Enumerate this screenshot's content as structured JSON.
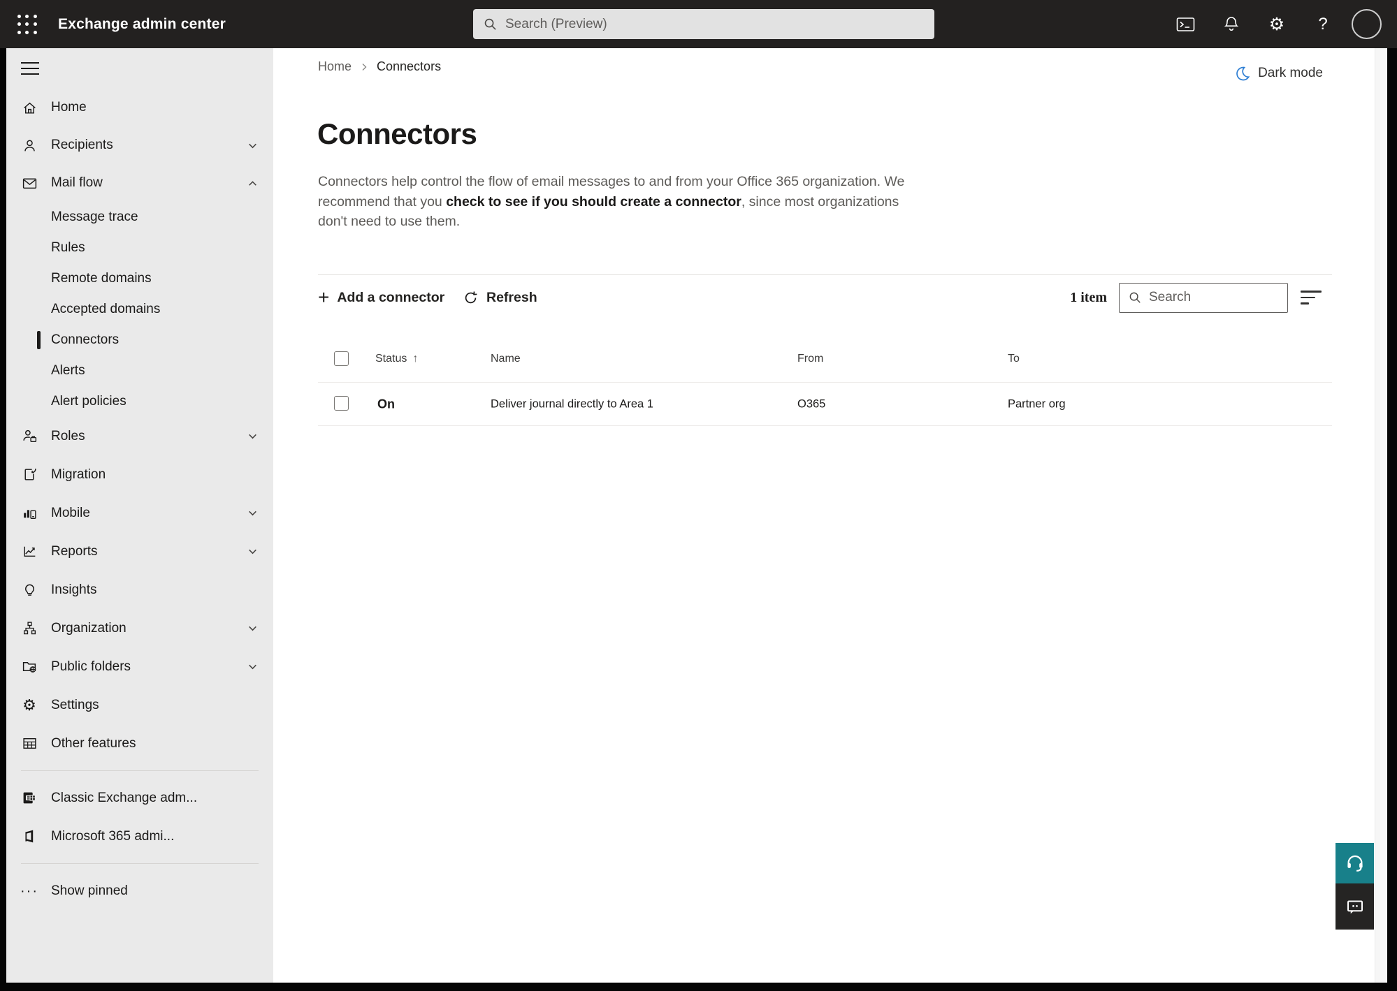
{
  "colors": {
    "topbar_bg": "#232120",
    "sidebar_bg": "#eaeaea",
    "accent_teal": "#18808a",
    "feedback_dark": "#252423",
    "dark_mode_blue": "#2f7fd4",
    "selection_bar": "#1b1a19"
  },
  "icons": {
    "topbar": [
      "app-launcher-grid",
      "search-magnifier",
      "terminal-window",
      "bell",
      "gear",
      "question-mark",
      "avatar-circle"
    ],
    "sidebar": [
      "hamburger",
      "home",
      "person",
      "envelope",
      "person-briefcase",
      "page-arrow",
      "bars-phone",
      "line-chart",
      "lightbulb",
      "org-tree",
      "folder-globe",
      "gear",
      "table-grid",
      "exchange-logo",
      "m365-logo",
      "ellipsis"
    ],
    "main": [
      "crescent-moon",
      "plus",
      "refresh-arrow",
      "magnifier",
      "sort-filter-lines",
      "sort-up-arrow",
      "headset",
      "chat-bubble"
    ]
  },
  "topbar": {
    "title": "Exchange admin center",
    "search_placeholder": "Search (Preview)"
  },
  "sidebar": {
    "items": [
      {
        "label": "Home"
      },
      {
        "label": "Recipients"
      },
      {
        "label": "Mail flow"
      },
      {
        "label": "Message trace"
      },
      {
        "label": "Rules"
      },
      {
        "label": "Remote domains"
      },
      {
        "label": "Accepted domains"
      },
      {
        "label": "Connectors"
      },
      {
        "label": "Alerts"
      },
      {
        "label": "Alert policies"
      },
      {
        "label": "Roles"
      },
      {
        "label": "Migration"
      },
      {
        "label": "Mobile"
      },
      {
        "label": "Reports"
      },
      {
        "label": "Insights"
      },
      {
        "label": "Organization"
      },
      {
        "label": "Public folders"
      },
      {
        "label": "Settings"
      },
      {
        "label": "Other features"
      },
      {
        "label": "Classic Exchange adm..."
      },
      {
        "label": "Microsoft 365 admi..."
      },
      {
        "label": "Show pinned"
      }
    ]
  },
  "breadcrumb": {
    "home": "Home",
    "current": "Connectors"
  },
  "header": {
    "dark_mode_label": "Dark mode"
  },
  "page": {
    "title": "Connectors",
    "desc_1": "Connectors help control the flow of email messages to and from your Office 365 organization. We recommend that you ",
    "desc_emphasis": "check to see if you should create a connector",
    "desc_2": ", since most organizations don't need to use them."
  },
  "toolbar": {
    "add_label": "Add a connector",
    "refresh_label": "Refresh",
    "item_count": "1 item",
    "search_placeholder": "Search"
  },
  "table": {
    "headers": {
      "status": "Status",
      "name": "Name",
      "from": "From",
      "to": "To"
    },
    "rows": [
      {
        "status": "On",
        "name": "Deliver journal directly to Area 1",
        "from": "O365",
        "to": "Partner org"
      }
    ]
  }
}
